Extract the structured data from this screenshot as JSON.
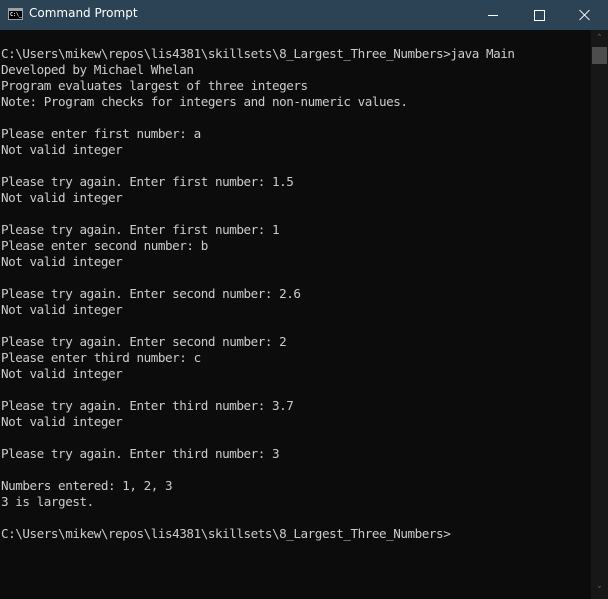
{
  "window": {
    "title": "Command Prompt",
    "icon": "cmd-icon",
    "icon_text": "C:\\_",
    "controls": {
      "minimize": "minimize-icon",
      "maximize": "maximize-icon",
      "close": "close-icon"
    },
    "colors": {
      "titlebar": "#2b4354",
      "console_bg": "#0c0c0c",
      "console_fg": "#cccccc"
    }
  },
  "console": {
    "lines": [
      "C:\\Users\\mikew\\repos\\lis4381\\skillsets\\8_Largest_Three_Numbers>java Main",
      "Developed by Michael Whelan",
      "Program evaluates largest of three integers",
      "Note: Program checks for integers and non-numeric values.",
      "",
      "Please enter first number: a",
      "Not valid integer",
      "",
      "Please try again. Enter first number: 1.5",
      "Not valid integer",
      "",
      "Please try again. Enter first number: 1",
      "Please enter second number: b",
      "Not valid integer",
      "",
      "Please try again. Enter second number: 2.6",
      "Not valid integer",
      "",
      "Please try again. Enter second number: 2",
      "Please enter third number: c",
      "Not valid integer",
      "",
      "Please try again. Enter third number: 3.7",
      "Not valid integer",
      "",
      "Please try again. Enter third number: 3",
      "",
      "Numbers entered: 1, 2, 3",
      "3 is largest.",
      "",
      "C:\\Users\\mikew\\repos\\lis4381\\skillsets\\8_Largest_Three_Numbers>"
    ]
  },
  "scrollbar": {
    "up_arrow": "˄",
    "down_arrow": "˅",
    "position": 0
  }
}
